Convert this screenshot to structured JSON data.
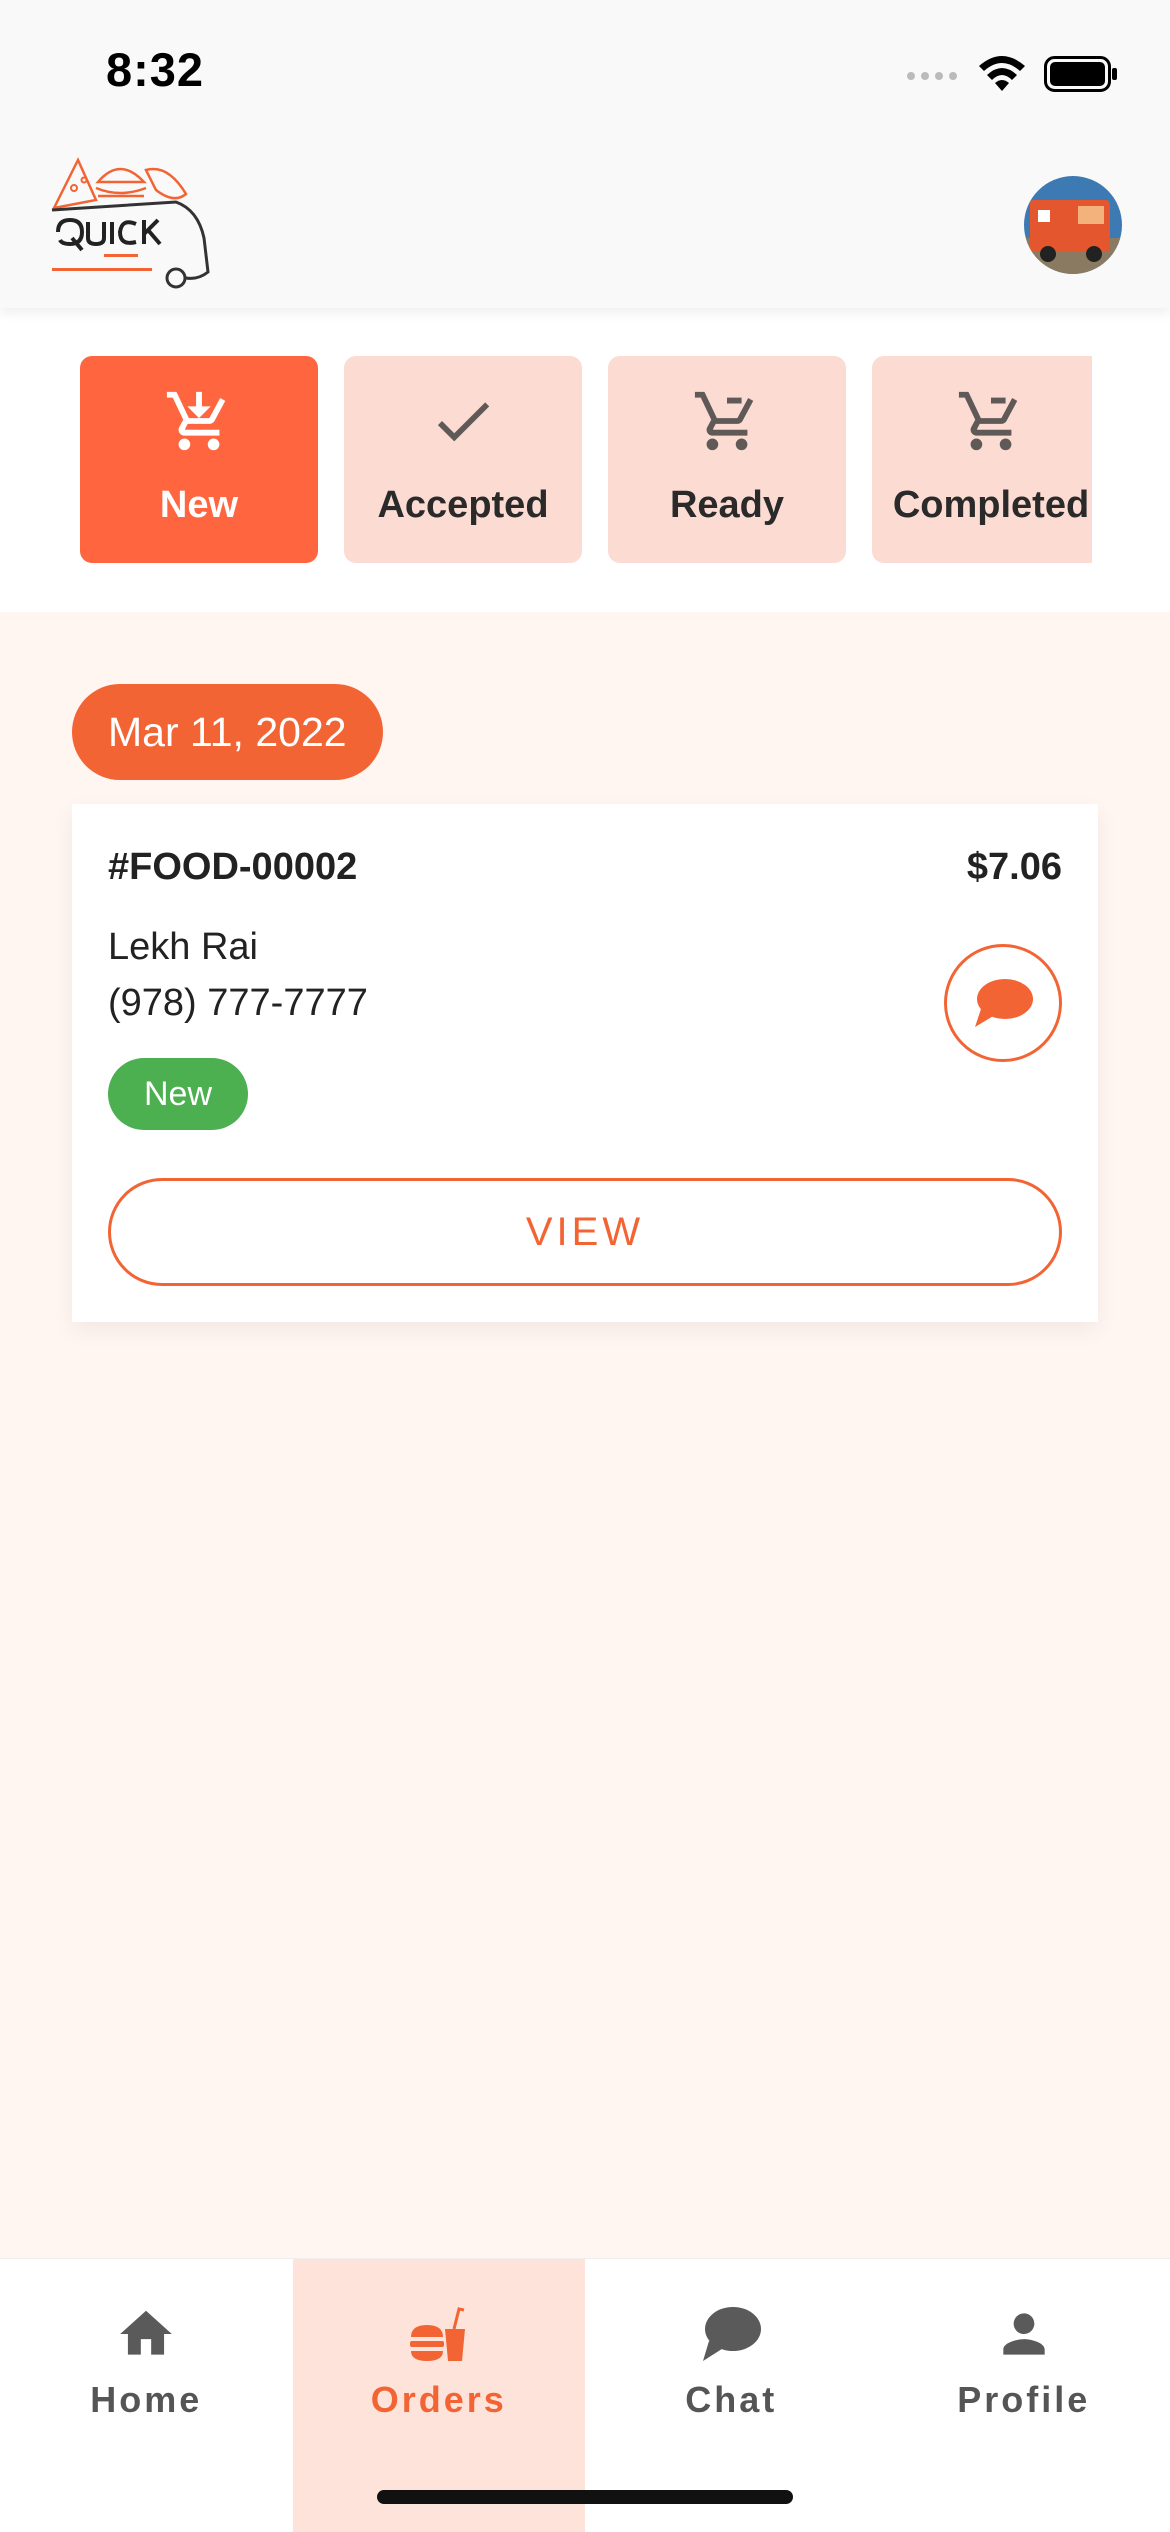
{
  "status_bar": {
    "time": "8:32"
  },
  "header": {
    "logo_alt": "QUICK FOOD TRUCK FINDER"
  },
  "filters": [
    {
      "label": "New",
      "icon": "cart-download-icon",
      "active": true
    },
    {
      "label": "Accepted",
      "icon": "checkmark-icon",
      "active": false
    },
    {
      "label": "Ready",
      "icon": "cart-icon",
      "active": false
    },
    {
      "label": "Completed",
      "icon": "cart-icon",
      "active": false
    }
  ],
  "orders": {
    "date": "Mar 11, 2022",
    "items": [
      {
        "id": "#FOOD-00002",
        "price": "$7.06",
        "customer": "Lekh Rai",
        "phone": "(978) 777-7777",
        "status": "New",
        "view_label": "VIEW"
      }
    ]
  },
  "bottom_nav": [
    {
      "label": "Home",
      "icon": "home-icon",
      "active": false
    },
    {
      "label": "Orders",
      "icon": "orders-icon",
      "active": true
    },
    {
      "label": "Chat",
      "icon": "chat-icon",
      "active": false
    },
    {
      "label": "Profile",
      "icon": "profile-icon",
      "active": false
    }
  ],
  "colors": {
    "accent": "#f26434",
    "tab_active": "#ff6640",
    "tab_inactive": "#fcdbd2",
    "status_new": "#4caf50",
    "background": "#fff5f1"
  }
}
